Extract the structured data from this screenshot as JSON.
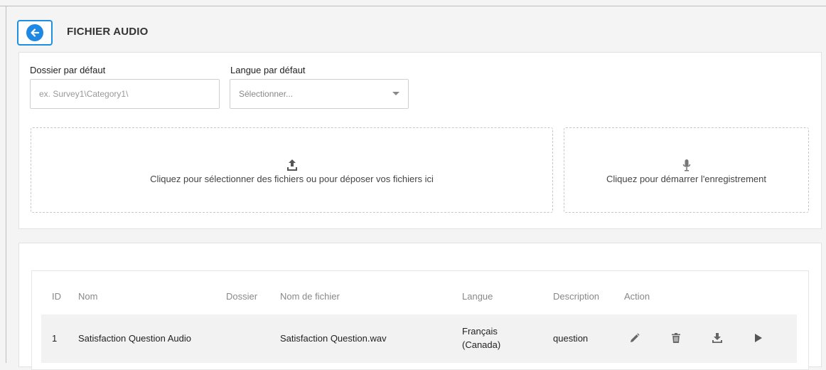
{
  "header": {
    "back_icon": "arrow-left-icon",
    "title": "FICHIER AUDIO"
  },
  "settings": {
    "folder_label": "Dossier par défaut",
    "folder_placeholder": "ex. Survey1\\Category1\\",
    "language_label": "Langue par défaut",
    "language_value": "Sélectionner..."
  },
  "upload": {
    "icon": "upload-icon",
    "text": "Cliquez pour sélectionner des fichiers ou pour déposer vos fichiers ici"
  },
  "record": {
    "icon": "microphone-icon",
    "text": "Cliquez pour démarrer l'enregistrement"
  },
  "table": {
    "columns": [
      "ID",
      "Nom",
      "Dossier",
      "Nom de fichier",
      "Langue",
      "Description",
      "Action"
    ],
    "rows": [
      {
        "id": "1",
        "name": "Satisfaction Question Audio",
        "folder": "",
        "filename": "Satisfaction Question.wav",
        "language_line1": "Français",
        "language_line2": "(Canada)",
        "description": "question",
        "actions": [
          "pencil-icon",
          "trash-icon",
          "download-icon",
          "play-icon"
        ]
      }
    ]
  },
  "colors": {
    "accent": "#1e88e5",
    "icon": "#666666",
    "row_bg": "#f2f2f2"
  }
}
